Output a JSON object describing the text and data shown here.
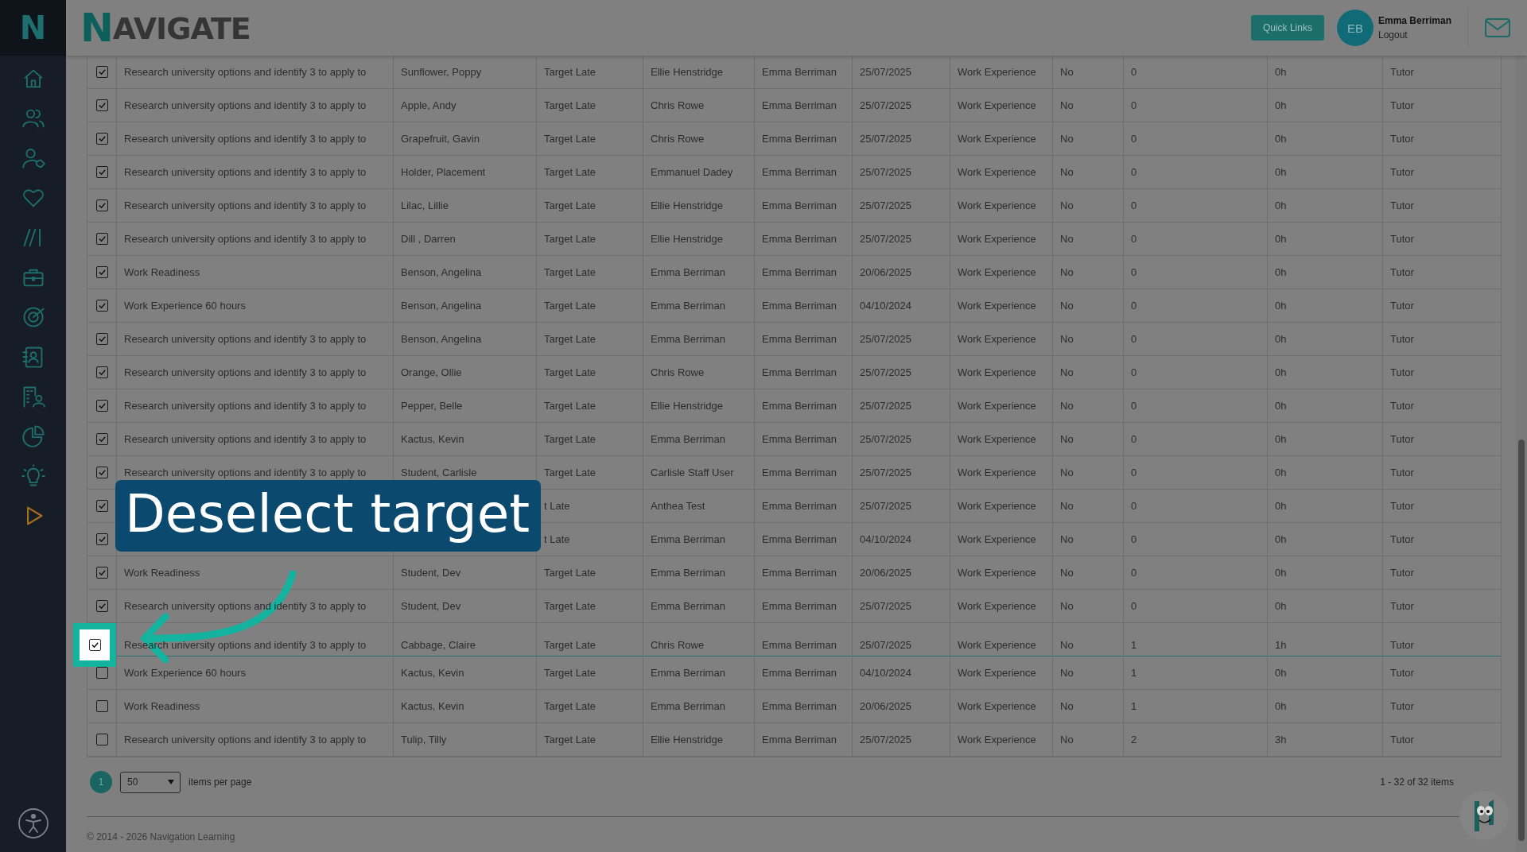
{
  "sidebar": {
    "logo": "N"
  },
  "header": {
    "logo": {
      "initial": "N",
      "rest": "AVIGATE"
    },
    "quick_links": "Quick Links",
    "user": {
      "initials": "EB",
      "name": "Emma Berriman",
      "logout": "Logout"
    }
  },
  "table": {
    "rows": [
      {
        "checked": true,
        "spotlight": false,
        "column_1": "Research university options and identify 3 to apply to",
        "column_2": "Sunflower, Poppy",
        "column_3": "Target Late",
        "column_4": "Ellie Henstridge",
        "column_5": "Emma Berriman",
        "column_6": "25/07/2025",
        "column_7": "Work Experience",
        "column_8": "No",
        "column_9": "0",
        "column_10": "0h",
        "column_11": "Tutor"
      },
      {
        "checked": true,
        "spotlight": false,
        "column_1": "Research university options and identify 3 to apply to",
        "column_2": "Apple, Andy",
        "column_3": "Target Late",
        "column_4": "Chris Rowe",
        "column_5": "Emma Berriman",
        "column_6": "25/07/2025",
        "column_7": "Work Experience",
        "column_8": "No",
        "column_9": "0",
        "column_10": "0h",
        "column_11": "Tutor"
      },
      {
        "checked": true,
        "spotlight": false,
        "column_1": "Research university options and identify 3 to apply to",
        "column_2": "Grapefruit, Gavin",
        "column_3": "Target Late",
        "column_4": "Chris Rowe",
        "column_5": "Emma Berriman",
        "column_6": "25/07/2025",
        "column_7": "Work Experience",
        "column_8": "No",
        "column_9": "0",
        "column_10": "0h",
        "column_11": "Tutor"
      },
      {
        "checked": true,
        "spotlight": false,
        "column_1": "Research university options and identify 3 to apply to",
        "column_2": "Holder, Placement",
        "column_3": "Target Late",
        "column_4": "Emmanuel Dadey",
        "column_5": "Emma Berriman",
        "column_6": "25/07/2025",
        "column_7": "Work Experience",
        "column_8": "No",
        "column_9": "0",
        "column_10": "0h",
        "column_11": "Tutor"
      },
      {
        "checked": true,
        "spotlight": false,
        "column_1": "Research university options and identify 3 to apply to",
        "column_2": "Lilac, Lillie",
        "column_3": "Target Late",
        "column_4": "Ellie Henstridge",
        "column_5": "Emma Berriman",
        "column_6": "25/07/2025",
        "column_7": "Work Experience",
        "column_8": "No",
        "column_9": "0",
        "column_10": "0h",
        "column_11": "Tutor"
      },
      {
        "checked": true,
        "spotlight": false,
        "column_1": "Research university options and identify 3 to apply to",
        "column_2": "Dill , Darren",
        "column_3": "Target Late",
        "column_4": "Ellie Henstridge",
        "column_5": "Emma Berriman",
        "column_6": "25/07/2025",
        "column_7": "Work Experience",
        "column_8": "No",
        "column_9": "0",
        "column_10": "0h",
        "column_11": "Tutor"
      },
      {
        "checked": true,
        "spotlight": false,
        "column_1": "Work Readiness",
        "column_2": "Benson, Angelina",
        "column_3": "Target Late",
        "column_4": "Emma Berriman",
        "column_5": "Emma Berriman",
        "column_6": "20/06/2025",
        "column_7": "Work Experience",
        "column_8": "No",
        "column_9": "0",
        "column_10": "0h",
        "column_11": "Tutor"
      },
      {
        "checked": true,
        "spotlight": false,
        "column_1": "Work Experience 60 hours",
        "column_2": "Benson, Angelina",
        "column_3": "Target Late",
        "column_4": "Emma Berriman",
        "column_5": "Emma Berriman",
        "column_6": "04/10/2024",
        "column_7": "Work Experience",
        "column_8": "No",
        "column_9": "0",
        "column_10": "0h",
        "column_11": "Tutor"
      },
      {
        "checked": true,
        "spotlight": false,
        "column_1": "Research university options and identify 3 to apply to",
        "column_2": "Benson, Angelina",
        "column_3": "Target Late",
        "column_4": "Emma Berriman",
        "column_5": "Emma Berriman",
        "column_6": "25/07/2025",
        "column_7": "Work Experience",
        "column_8": "No",
        "column_9": "0",
        "column_10": "0h",
        "column_11": "Tutor"
      },
      {
        "checked": true,
        "spotlight": false,
        "column_1": "Research university options and identify 3 to apply to",
        "column_2": "Orange, Ollie",
        "column_3": "Target Late",
        "column_4": "Chris Rowe",
        "column_5": "Emma Berriman",
        "column_6": "25/07/2025",
        "column_7": "Work Experience",
        "column_8": "No",
        "column_9": "0",
        "column_10": "0h",
        "column_11": "Tutor"
      },
      {
        "checked": true,
        "spotlight": false,
        "column_1": "Research university options and identify 3 to apply to",
        "column_2": "Pepper, Belle",
        "column_3": "Target Late",
        "column_4": "Ellie Henstridge",
        "column_5": "Emma Berriman",
        "column_6": "25/07/2025",
        "column_7": "Work Experience",
        "column_8": "No",
        "column_9": "0",
        "column_10": "0h",
        "column_11": "Tutor"
      },
      {
        "checked": true,
        "spotlight": false,
        "column_1": "Research university options and identify 3 to apply to",
        "column_2": "Kactus, Kevin",
        "column_3": "Target Late",
        "column_4": "Emma Berriman",
        "column_5": "Emma Berriman",
        "column_6": "25/07/2025",
        "column_7": "Work Experience",
        "column_8": "No",
        "column_9": "0",
        "column_10": "0h",
        "column_11": "Tutor"
      },
      {
        "checked": true,
        "spotlight": false,
        "column_1": "Research university options and identify 3 to apply to",
        "column_2": "Student, Carlisle",
        "column_3": "Target Late",
        "column_4": "Carlisle Staff User",
        "column_5": "Emma Berriman",
        "column_6": "25/07/2025",
        "column_7": "Work Experience",
        "column_8": "No",
        "column_9": "0",
        "column_10": "0h",
        "column_11": "Tutor"
      },
      {
        "checked": true,
        "spotlight": false,
        "column_3": "t Late",
        "column_4": "Anthea Test",
        "column_5": "Emma Berriman",
        "column_6": "25/07/2025",
        "column_7": "Work Experience",
        "column_8": "No",
        "column_9": "0",
        "column_10": "0h",
        "column_11": "Tutor"
      },
      {
        "checked": true,
        "spotlight": false,
        "column_3": "t Late",
        "column_4": "Emma Berriman",
        "column_5": "Emma Berriman",
        "column_6": "04/10/2024",
        "column_7": "Work Experience",
        "column_8": "No",
        "column_9": "0",
        "column_10": "0h",
        "column_11": "Tutor"
      },
      {
        "checked": true,
        "spotlight": false,
        "column_1": "Work Readiness",
        "column_2": "Student, Dev",
        "column_3": "Target Late",
        "column_4": "Emma Berriman",
        "column_5": "Emma Berriman",
        "column_6": "20/06/2025",
        "column_7": "Work Experience",
        "column_8": "No",
        "column_9": "0",
        "column_10": "0h",
        "column_11": "Tutor"
      },
      {
        "checked": true,
        "spotlight": false,
        "column_1": "Research university options and identify 3 to apply to",
        "column_2": "Student, Dev",
        "column_3": "Target Late",
        "column_4": "Emma Berriman",
        "column_5": "Emma Berriman",
        "column_6": "25/07/2025",
        "column_7": "Work Experience",
        "column_8": "No",
        "column_9": "0",
        "column_10": "0h",
        "column_11": "Tutor"
      },
      {
        "checked": true,
        "spotlight": true,
        "column_1": "Research university options and identify 3 to apply to",
        "column_2": "Cabbage, Claire",
        "column_3": "Target Late",
        "column_4": "Chris Rowe",
        "column_5": "Emma Berriman",
        "column_6": "25/07/2025",
        "column_7": "Work Experience",
        "column_8": "No",
        "column_9": "1",
        "column_10": "1h",
        "column_11": "Tutor"
      },
      {
        "checked": false,
        "spotlight": false,
        "column_1": "Work Experience 60 hours",
        "column_2": "Kactus, Kevin",
        "column_3": "Target Late",
        "column_4": "Emma Berriman",
        "column_5": "Emma Berriman",
        "column_6": "04/10/2024",
        "column_7": "Work Experience",
        "column_8": "No",
        "column_9": "1",
        "column_10": "0h",
        "column_11": "Tutor"
      },
      {
        "checked": false,
        "spotlight": false,
        "column_1": "Work Readiness",
        "column_2": "Kactus, Kevin",
        "column_3": "Target Late",
        "column_4": "Emma Berriman",
        "column_5": "Emma Berriman",
        "column_6": "20/06/2025",
        "column_7": "Work Experience",
        "column_8": "No",
        "column_9": "1",
        "column_10": "0h",
        "column_11": "Tutor"
      },
      {
        "checked": false,
        "spotlight": false,
        "column_1": "Research university options and identify 3 to apply to",
        "column_2": "Tulip, Tilly",
        "column_3": "Target Late",
        "column_4": "Ellie Henstridge",
        "column_5": "Emma Berriman",
        "column_6": "25/07/2025",
        "column_7": "Work Experience",
        "column_8": "No",
        "column_9": "2",
        "column_10": "3h",
        "column_11": "Tutor"
      }
    ]
  },
  "callout": {
    "text": "Deselect target"
  },
  "pager": {
    "page": "1",
    "page_size": "50",
    "per_page_label": "items per page",
    "summary": "1 - 32 of 32 items"
  },
  "footer": {
    "copyright": "© 2014 - 2026 Navigation Learning"
  }
}
